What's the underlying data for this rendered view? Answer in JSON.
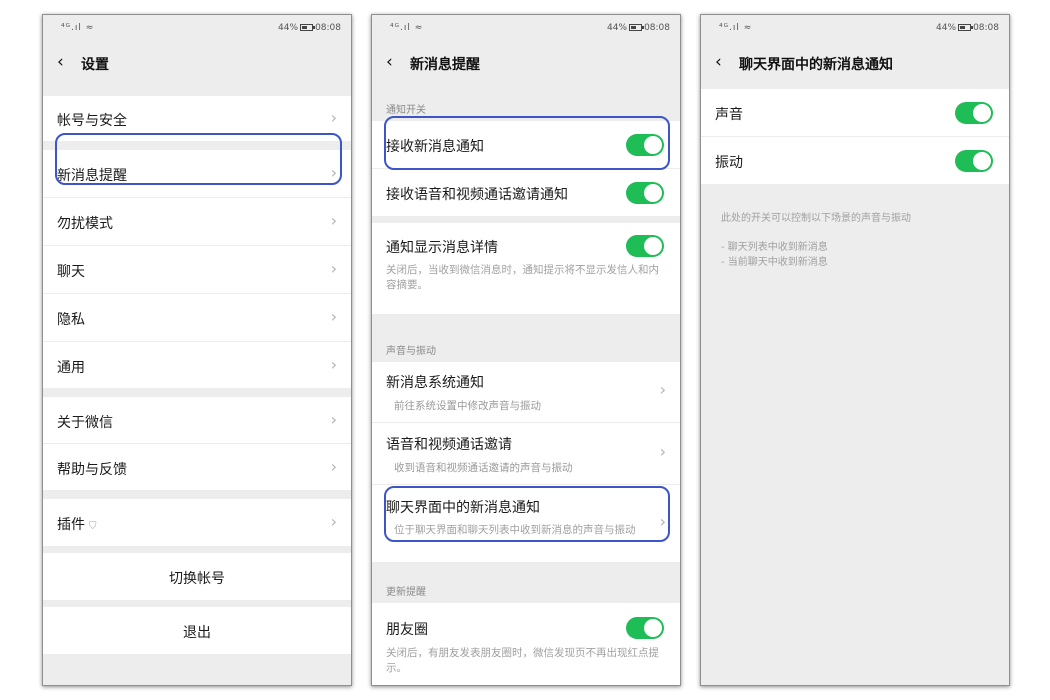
{
  "status": {
    "signal": "⁴ᴳ.ıl ≈",
    "battery": "44%",
    "time": "08:08"
  },
  "screen1": {
    "title": "设置",
    "items": [
      "帐号与安全",
      "新消息提醒",
      "勿扰模式",
      "聊天",
      "隐私",
      "通用",
      "关于微信",
      "帮助与反馈",
      "插件"
    ],
    "switch_account": "切换帐号",
    "logout": "退出"
  },
  "screen2": {
    "title": "新消息提醒",
    "section_notify": "通知开关",
    "receive_new": "接收新消息通知",
    "receive_call": "接收语音和视频通话邀请通知",
    "show_detail": "通知显示消息详情",
    "show_detail_desc": "关闭后，当收到微信消息时，通知提示将不显示发信人和内容摘要。",
    "section_sound": "声音与振动",
    "sys_notify": "新消息系统通知",
    "sys_notify_sub": "前往系统设置中修改声音与振动",
    "call_invite": "语音和视频通话邀请",
    "call_invite_sub": "收到语音和视频通话邀请的声音与振动",
    "chat_notify": "聊天界面中的新消息通知",
    "chat_notify_sub": "位于聊天界面和聊天列表中收到新消息的声音与振动",
    "section_update": "更新提醒",
    "moments": "朋友圈",
    "moments_desc": "关闭后，有朋友发表朋友圈时，微信发现页不再出现红点提示。"
  },
  "screen3": {
    "title": "聊天界面中的新消息通知",
    "sound": "声音",
    "vibrate": "振动",
    "note": "此处的开关可以控制以下场景的声音与振动",
    "line1": "- 聊天列表中收到新消息",
    "line2": "- 当前聊天中收到新消息"
  },
  "colors": {
    "accent_green": "#1fbd55",
    "highlight_blue": "#3d55c9",
    "background": "#ededed"
  },
  "icons": {
    "back": "chevron-left-icon",
    "arrow": "chevron-right-icon",
    "plugin": "shield-icon"
  }
}
